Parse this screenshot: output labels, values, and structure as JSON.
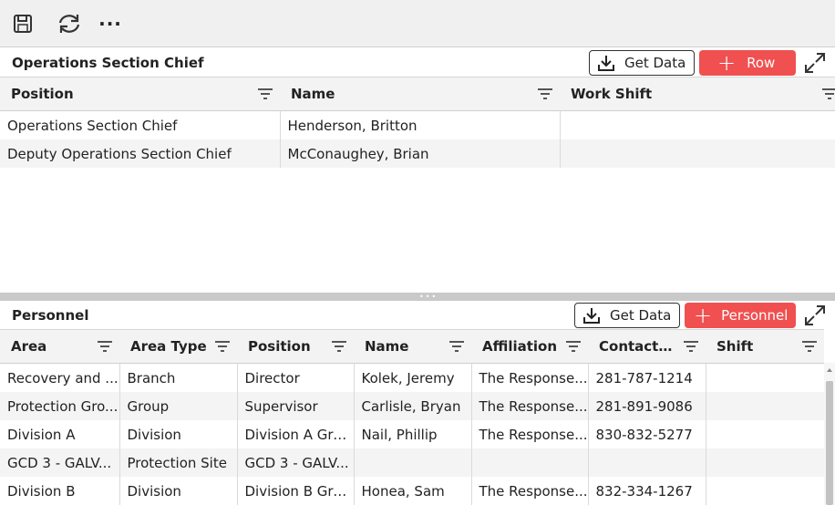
{
  "toolbar": {
    "save_icon": "save-icon",
    "refresh_icon": "refresh-icon",
    "more_icon": "more-icon",
    "more_label": "···"
  },
  "top_panel": {
    "title": "Operations Section Chief",
    "get_data_label": "Get Data",
    "add_label": "Row",
    "columns": [
      "Position",
      "Name",
      "Work Shift"
    ],
    "rows": [
      [
        "Operations Section Chief",
        "Henderson, Britton",
        ""
      ],
      [
        "Deputy Operations Section Chief",
        "McConaughey, Brian",
        ""
      ]
    ]
  },
  "bottom_panel": {
    "title": "Personnel",
    "get_data_label": "Get Data",
    "add_label": "Personnel",
    "columns": [
      "Area",
      "Area Type",
      "Position",
      "Name",
      "Affiliation",
      "Contact ...",
      "Shift"
    ],
    "rows": [
      [
        "Recovery and ...",
        "Branch",
        "Director",
        "Kolek, Jeremy",
        "The Response...",
        "281-787-1214",
        ""
      ],
      [
        "Protection Gro...",
        "Group",
        "Supervisor",
        "Carlisle, Bryan",
        "The Response...",
        "281-891-9086",
        ""
      ],
      [
        "Division A",
        "Division",
        "Division A Gro...",
        "Nail, Phillip",
        "The Response...",
        "830-832-5277",
        ""
      ],
      [
        "GCD 3 - GALV...",
        "Protection Site",
        "GCD 3 - GALV...",
        "",
        "",
        "",
        ""
      ],
      [
        "Division B",
        "Division",
        "Division B Gro...",
        "Honea, Sam",
        "The Response...",
        "832-334-1267",
        ""
      ]
    ]
  },
  "colors": {
    "accent": "#f05050",
    "header_bg": "#f3f3f3",
    "toolbar_bg": "#f0f0f0"
  }
}
